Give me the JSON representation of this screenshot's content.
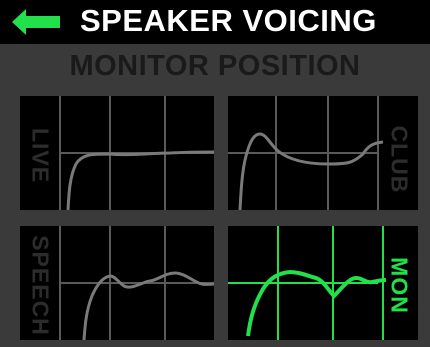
{
  "header": {
    "title": "SPEAKER VOICING",
    "back_icon": "arrow-left-icon"
  },
  "section_title": "MONITOR POSITION",
  "colors": {
    "accent": "#22e04a",
    "inactive_text": "#2c2c2c",
    "curve_gray": "#7a7a7a",
    "grid_gray": "#5a5a5a"
  },
  "presets": [
    {
      "label": "LIVE",
      "selected": false
    },
    {
      "label": "CLUB",
      "selected": false
    },
    {
      "label": "SPEECH",
      "selected": false
    },
    {
      "label": "MON",
      "selected": true
    }
  ]
}
